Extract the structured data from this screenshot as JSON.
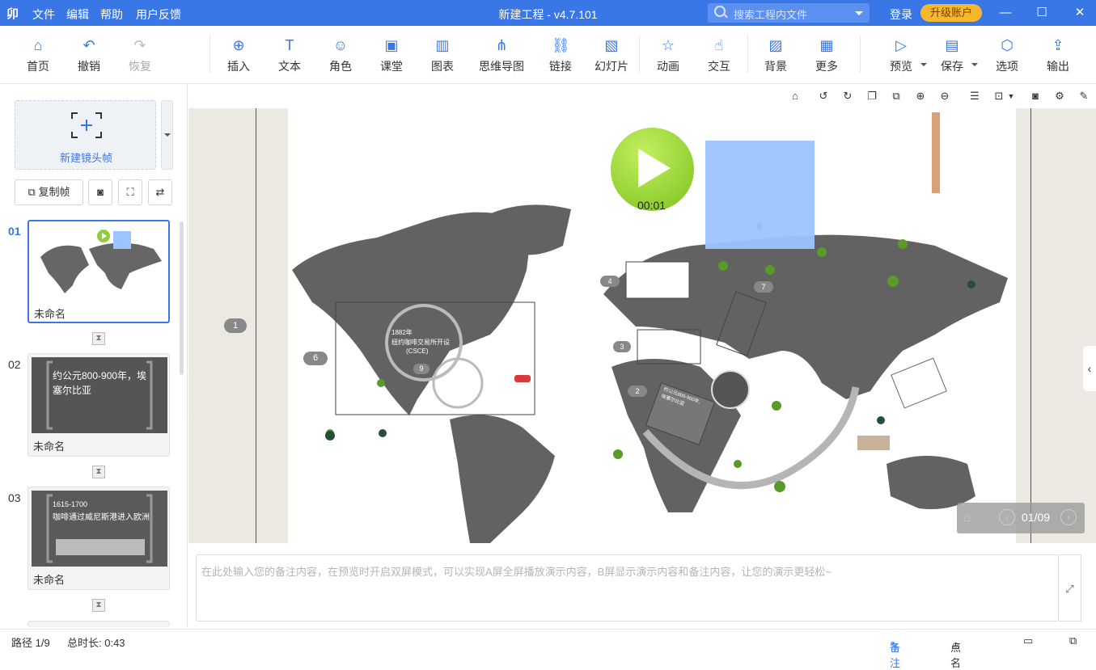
{
  "window": {
    "logo": "卯",
    "menus": [
      "文件",
      "编辑",
      "帮助",
      "用户反馈"
    ],
    "title": "新建工程 - v4.7.101",
    "search_placeholder": "搜索工程内文件",
    "login": "登录",
    "upgrade": "升级账户",
    "accent": "#3a77e6"
  },
  "toolbar": {
    "home": "首页",
    "undo": "撤销",
    "redo": "恢复",
    "insert": "插入",
    "text": "文本",
    "role": "角色",
    "classroom": "课堂",
    "chart": "图表",
    "mindmap": "思维导图",
    "link": "链接",
    "slideshow": "幻灯片",
    "animation": "动画",
    "interact": "交互",
    "background": "背景",
    "more": "更多",
    "preview": "预览",
    "save": "保存",
    "options": "选项",
    "export": "输出"
  },
  "left_panel": {
    "new_frame": "新建镜头帧",
    "copy_frame": "复制帧",
    "slides": [
      {
        "num": "01",
        "name": "未命名"
      },
      {
        "num": "02",
        "name": "未命名",
        "caption": "约公元800-900年，埃塞尔比亚"
      },
      {
        "num": "03",
        "name": "未命名",
        "caption": "1615-1700",
        "sub": "咖啡通过威尼斯港进入欧洲"
      }
    ]
  },
  "stage": {
    "timer": "00:01",
    "markers": [
      "1",
      "2",
      "3",
      "4",
      "6",
      "7",
      "9"
    ],
    "label_1882": "1882年",
    "label_csce": "纽约咖啡交易所开设",
    "label_csce2": "(CSCE)",
    "label_ethiopia": "约公元800-900年,埃塞尔比亚"
  },
  "nav": {
    "page": "01/09"
  },
  "notes": {
    "placeholder": "在此处输入您的备注内容，在预览时开启双屏模式，可以实现A屏全屏播放演示内容，B屏显示演示内容和备注内容，让您的演示更轻松~"
  },
  "status": {
    "path": "路径 1/9",
    "duration": "总时长: 0:43",
    "notes": "备注",
    "rollcall": "点名"
  }
}
